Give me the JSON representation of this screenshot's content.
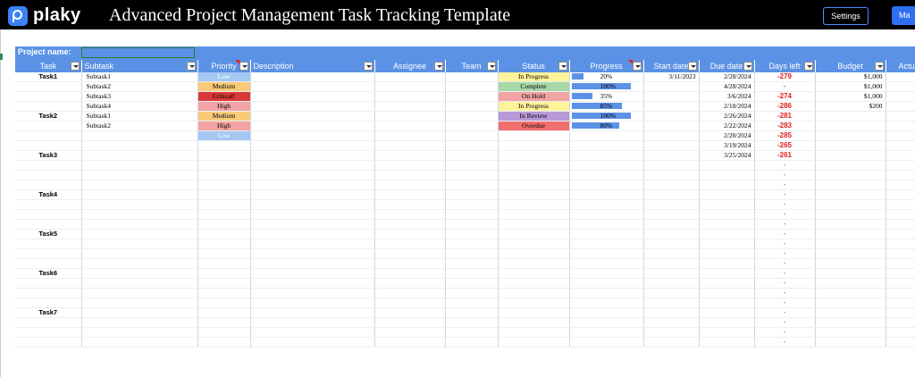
{
  "app": {
    "logo": "plaky",
    "title": "Advanced Project Management Task Tracking Template"
  },
  "header_buttons": {
    "settings": "Settings",
    "make": "Ma"
  },
  "project": {
    "label": "Project name:",
    "value": ""
  },
  "columns": [
    "Task",
    "Subtask",
    "Priority",
    "Description",
    "Assignee",
    "Team",
    "Status",
    "Progress",
    "Start date",
    "Due date",
    "Days left",
    "Budget",
    "Actual co"
  ],
  "rows": [
    {
      "task": "Task1",
      "subtask": "Subtask1",
      "priority": "Low",
      "status": "In Progress",
      "progress": 20,
      "progress_label": "20%",
      "start": "3/11/2023",
      "due": "2/28/2024",
      "days": "-279",
      "budget": "$1,000",
      "actual": ""
    },
    {
      "task": "",
      "subtask": "Subtask2",
      "priority": "Medium",
      "status": "Complete",
      "progress": 100,
      "progress_label": "100%",
      "start": "",
      "due": "4/28/2024",
      "days": "-",
      "budget": "$1,000",
      "actual": "$"
    },
    {
      "task": "",
      "subtask": "Subtask3",
      "priority": "Critical!",
      "status": "On Hold",
      "progress": 35,
      "progress_label": "35%",
      "start": "",
      "due": "3/6/2024",
      "days": "-274",
      "budget": "$1,000",
      "actual": "$"
    },
    {
      "task": "",
      "subtask": "Subtask4",
      "priority": "High",
      "status": "In Progress",
      "progress": 85,
      "progress_label": "85%",
      "start": "",
      "due": "2/18/2024",
      "days": "-286",
      "budget": "$200",
      "actual": ""
    },
    {
      "task": "Task2",
      "subtask": "Subtask1",
      "priority": "Medium",
      "status": "In Review",
      "progress": 100,
      "progress_label": "100%",
      "start": "",
      "due": "2/26/2024",
      "days": "-281",
      "budget": "",
      "actual": ""
    },
    {
      "task": "",
      "subtask": "Subtask2",
      "priority": "High",
      "status": "Overdue",
      "progress": 80,
      "progress_label": "80%",
      "start": "",
      "due": "2/22/2024",
      "days": "-283",
      "budget": "",
      "actual": ""
    },
    {
      "task": "",
      "subtask": "",
      "priority": "Low",
      "status": "",
      "progress": null,
      "progress_label": "",
      "start": "",
      "due": "2/20/2024",
      "days": "-285",
      "budget": "",
      "actual": ""
    },
    {
      "task": "",
      "subtask": "",
      "priority": "",
      "status": "",
      "progress": null,
      "progress_label": "",
      "start": "",
      "due": "3/19/2024",
      "days": "-265",
      "budget": "",
      "actual": ""
    },
    {
      "task": "Task3",
      "subtask": "",
      "priority": "",
      "status": "",
      "progress": null,
      "progress_label": "",
      "start": "",
      "due": "3/25/2024",
      "days": "-261",
      "budget": "",
      "actual": ""
    },
    {
      "task": "",
      "days": "-"
    },
    {
      "task": "",
      "days": "-"
    },
    {
      "task": "",
      "days": "-"
    },
    {
      "task": "Task4",
      "days": "-"
    },
    {
      "task": "",
      "days": "-"
    },
    {
      "task": "",
      "days": "-"
    },
    {
      "task": "",
      "days": "-"
    },
    {
      "task": "Task5",
      "days": "-"
    },
    {
      "task": "",
      "days": "-"
    },
    {
      "task": "",
      "days": "-"
    },
    {
      "task": "",
      "days": "-"
    },
    {
      "task": "Task6",
      "days": "-"
    },
    {
      "task": "",
      "days": "-"
    },
    {
      "task": "",
      "days": "-"
    },
    {
      "task": "",
      "days": "-"
    },
    {
      "task": "Task7",
      "days": "-"
    },
    {
      "task": "",
      "days": "-"
    },
    {
      "task": "",
      "days": "-"
    },
    {
      "task": "",
      "days": "-"
    }
  ],
  "colors": {
    "header_blue": "#5b92e5",
    "overdue_red": "#e02020",
    "ok_green": "#2e8b57"
  }
}
